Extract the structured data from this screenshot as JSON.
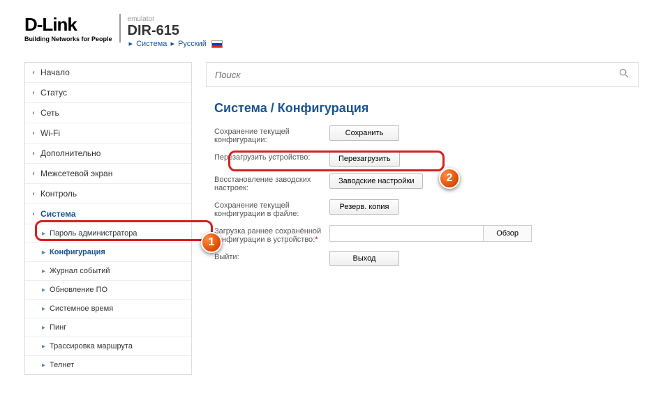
{
  "header": {
    "logo_main": "D-Link",
    "logo_tag": "Building Networks for People",
    "emulator": "emulator",
    "model": "DIR-615",
    "crumb_system": "Система",
    "crumb_lang": "Русский"
  },
  "search": {
    "placeholder": "Поиск"
  },
  "nav": {
    "main": [
      {
        "label": "Начало"
      },
      {
        "label": "Статус"
      },
      {
        "label": "Сеть"
      },
      {
        "label": "Wi-Fi"
      },
      {
        "label": "Дополнительно"
      },
      {
        "label": "Межсетевой экран"
      },
      {
        "label": "Контроль"
      },
      {
        "label": "Система",
        "active": true
      }
    ],
    "sub": [
      {
        "label": "Пароль администратора"
      },
      {
        "label": "Конфигурация",
        "selected": true
      },
      {
        "label": "Журнал событий"
      },
      {
        "label": "Обновление ПО"
      },
      {
        "label": "Системное время"
      },
      {
        "label": "Пинг"
      },
      {
        "label": "Трассировка маршрута"
      },
      {
        "label": "Телнет"
      }
    ]
  },
  "page_title": "Система /  Конфигурация",
  "form": {
    "rows": [
      {
        "label": "Сохранение текущей конфигурации:",
        "button": "Сохранить"
      },
      {
        "label": "Перезагрузить устройство:",
        "button": "Перезагрузить"
      },
      {
        "label": "Восстановление заводских настроек:",
        "button": "Заводские настройки"
      },
      {
        "label": "Сохранение текущей конфигурации в файле:",
        "button": "Резерв. копия"
      },
      {
        "label": "Загрузка раннее сохранённой конфигурации в устройство:",
        "req": "*",
        "file_btn": "Обзор"
      },
      {
        "label": "Выйти:",
        "button": "Выход"
      }
    ]
  },
  "markers": {
    "one": "1",
    "two": "2"
  }
}
